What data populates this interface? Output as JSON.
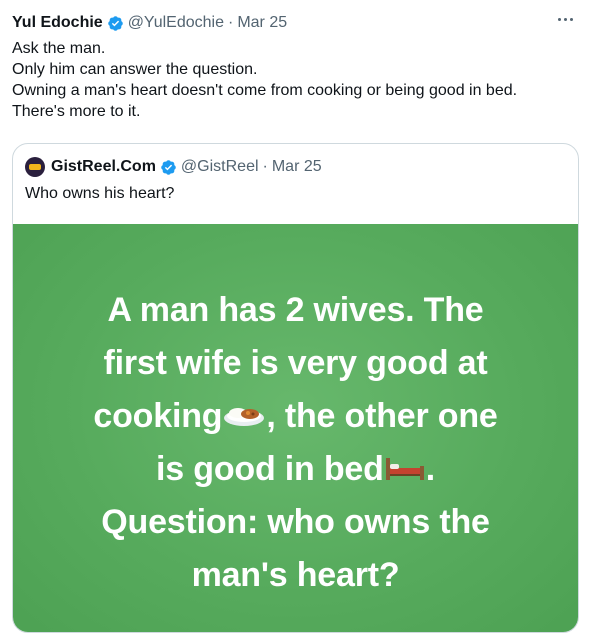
{
  "tweet": {
    "author_name": "Yul Edochie",
    "handle": "@YulEdochie",
    "separator": "·",
    "date": "Mar 25",
    "lines": [
      "Ask the man.",
      "Only him can answer the question.",
      "Owning a man's heart doesn't come from cooking or being good in bed.",
      "There's more to it."
    ]
  },
  "quote": {
    "author_name": "GistReel.Com",
    "handle": "@GistReel",
    "separator": "·",
    "date": "Mar 25",
    "text": "Who owns his heart?",
    "image_text": {
      "line1": "A man has 2 wives. The",
      "line2": "first wife is very good at",
      "line3_a": "cooking",
      "line3_b": ", the other one",
      "line4_a": "is good in bed",
      "line4_b": ".",
      "line5": "Question: who owns the",
      "line6": "man's heart?"
    },
    "image_bg": "#57ab5d"
  },
  "colors": {
    "verified": "#1d9bf0",
    "secondary_text": "#536471",
    "border": "#cfd9de"
  },
  "icons": {
    "verified": "verified-badge-icon",
    "more": "more-dots-icon",
    "food": "curry-rice-emoji",
    "bed": "bed-emoji"
  }
}
